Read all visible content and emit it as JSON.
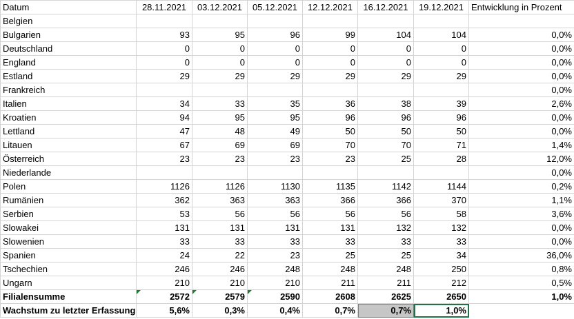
{
  "header": {
    "first": "Datum",
    "dates": [
      "28.11.2021",
      "03.12.2021",
      "05.12.2021",
      "12.12.2021",
      "16.12.2021",
      "19.12.2021"
    ],
    "last": "Entwicklung in Prozent"
  },
  "rows": [
    {
      "name": "Belgien",
      "values": [
        "",
        "",
        "",
        "",
        "",
        ""
      ],
      "pct": ""
    },
    {
      "name": "Bulgarien",
      "values": [
        "93",
        "95",
        "96",
        "99",
        "104",
        "104"
      ],
      "pct": "0,0%"
    },
    {
      "name": "Deutschland",
      "values": [
        "0",
        "0",
        "0",
        "0",
        "0",
        "0"
      ],
      "pct": "0,0%"
    },
    {
      "name": "England",
      "values": [
        "0",
        "0",
        "0",
        "0",
        "0",
        "0"
      ],
      "pct": "0,0%"
    },
    {
      "name": "Estland",
      "values": [
        "29",
        "29",
        "29",
        "29",
        "29",
        "29"
      ],
      "pct": "0,0%"
    },
    {
      "name": "Frankreich",
      "values": [
        "",
        "",
        "",
        "",
        "",
        ""
      ],
      "pct": "0,0%"
    },
    {
      "name": "Italien",
      "values": [
        "34",
        "33",
        "35",
        "36",
        "38",
        "39"
      ],
      "pct": "2,6%"
    },
    {
      "name": "Kroatien",
      "values": [
        "94",
        "95",
        "95",
        "96",
        "96",
        "96"
      ],
      "pct": "0,0%"
    },
    {
      "name": "Lettland",
      "values": [
        "47",
        "48",
        "49",
        "50",
        "50",
        "50"
      ],
      "pct": "0,0%"
    },
    {
      "name": "Litauen",
      "values": [
        "67",
        "69",
        "69",
        "70",
        "70",
        "71"
      ],
      "pct": "1,4%"
    },
    {
      "name": "Österreich",
      "values": [
        "23",
        "23",
        "23",
        "23",
        "25",
        "28"
      ],
      "pct": "12,0%"
    },
    {
      "name": "Niederlande",
      "values": [
        "",
        "",
        "",
        "",
        "",
        ""
      ],
      "pct": "0,0%"
    },
    {
      "name": "Polen",
      "values": [
        "1126",
        "1126",
        "1130",
        "1135",
        "1142",
        "1144"
      ],
      "pct": "0,2%"
    },
    {
      "name": "Rumänien",
      "values": [
        "362",
        "363",
        "363",
        "366",
        "366",
        "370"
      ],
      "pct": "1,1%"
    },
    {
      "name": "Serbien",
      "values": [
        "53",
        "56",
        "56",
        "56",
        "56",
        "58"
      ],
      "pct": "3,6%"
    },
    {
      "name": "Slowakei",
      "values": [
        "131",
        "131",
        "131",
        "131",
        "132",
        "132"
      ],
      "pct": "0,0%"
    },
    {
      "name": "Slowenien",
      "values": [
        "33",
        "33",
        "33",
        "33",
        "33",
        "33"
      ],
      "pct": "0,0%"
    },
    {
      "name": "Spanien",
      "values": [
        "24",
        "22",
        "23",
        "25",
        "25",
        "34"
      ],
      "pct": "36,0%"
    },
    {
      "name": "Tschechien",
      "values": [
        "246",
        "246",
        "248",
        "248",
        "248",
        "250"
      ],
      "pct": "0,8%"
    },
    {
      "name": "Ungarn",
      "values": [
        "210",
        "210",
        "210",
        "211",
        "211",
        "212"
      ],
      "pct": "0,5%"
    }
  ],
  "total": {
    "name": "Filialensumme",
    "values": [
      "2572",
      "2579",
      "2590",
      "2608",
      "2625",
      "2650"
    ],
    "pct": "1,0%"
  },
  "growth": {
    "name": "Wachstum zu letzter Erfassung",
    "values": [
      "5,6%",
      "0,3%",
      "0,4%",
      "0,7%",
      "0,7%",
      "1,0%"
    ]
  },
  "colors": {
    "gridline": "#d4d4d4",
    "selection_gray": "#c6c6c6",
    "active_border": "#217346",
    "error_triangle": "#1e7b2f"
  }
}
